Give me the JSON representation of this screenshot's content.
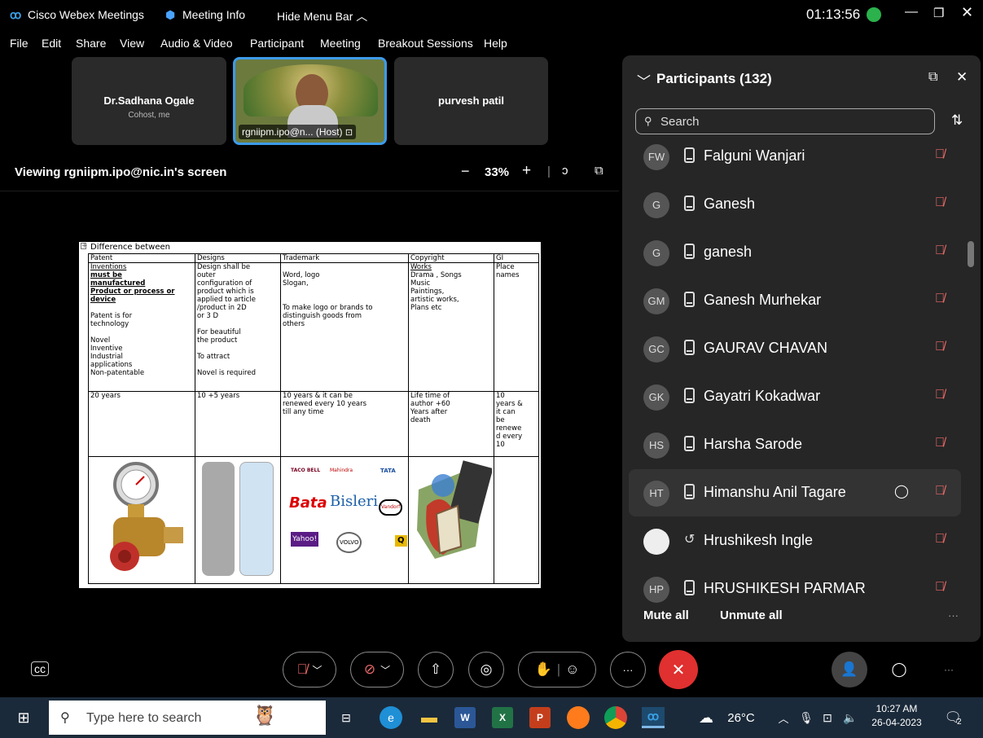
{
  "window": {
    "app_title": "Cisco Webex Meetings",
    "meeting_info": "Meeting Info",
    "hide_menu": "Hide Menu Bar",
    "timer": "01:13:56"
  },
  "menu": [
    "File",
    "Edit",
    "Share",
    "View",
    "Audio & Video",
    "Participant",
    "Meeting",
    "Breakout Sessions",
    "Help"
  ],
  "tiles": {
    "left": {
      "name": "Dr.Sadhana Ogale",
      "sub": "Cohost, me"
    },
    "center": {
      "label": "rgniipm.ipo@n... (Host)"
    },
    "right": {
      "name": "purvesh patil"
    }
  },
  "viewing": {
    "text": "Viewing rgniipm.ipo@nic.in's screen",
    "zoom": "33%",
    "minus": "−",
    "plus": "+"
  },
  "slide": {
    "title": "Difference between",
    "headers": [
      "Patent",
      "Designs",
      "Trademark",
      "Copyright",
      "GI"
    ],
    "row1": {
      "patent": [
        "Inventions",
        "must be",
        "manufactured",
        "Product  or process or",
        "device",
        "",
        "Patent is for",
        "technology",
        "",
        "Novel",
        "Inventive",
        "Industrial",
        "applications",
        "Non-patentable"
      ],
      "design": [
        "Design shall be",
        "outer",
        "configuration of",
        "product which is",
        "applied to article",
        "/product  in 2D",
        "or 3 D",
        "",
        "For beautiful",
        "the product",
        "",
        "To attract",
        "",
        "Novel is required"
      ],
      "trademark": [
        "",
        "Word, logo",
        "Slogan,",
        "",
        "",
        "To make logo or brands to",
        "distinguish  goods from",
        "others"
      ],
      "copyright": [
        "Works",
        "Drama , Songs",
        "Music",
        "Paintings,",
        "artistic works,",
        "Plans  etc"
      ],
      "gi": [
        "Place",
        "names"
      ]
    },
    "row2": {
      "patent": "20 years",
      "design": "10 +5 years",
      "trademark": [
        "10 years & it can be",
        "renewed  every  10 years",
        "till any time"
      ],
      "copyright": [
        "Life time of",
        "author +60",
        "Years after",
        "death"
      ],
      "gi": [
        "10",
        "years &",
        "it can",
        "be",
        "renewe",
        "d  every",
        "10"
      ]
    },
    "brands": [
      "TACO BELL",
      "Mahindra",
      "TATA",
      "Bata",
      "Bisleri",
      "Vandorf",
      "Yahoo!",
      "VOLVO",
      "Q"
    ]
  },
  "participants": {
    "header": "Participants (132)",
    "search_placeholder": "Search",
    "list": [
      {
        "initials": "FW",
        "name": "Falguni Wanjari"
      },
      {
        "initials": "G",
        "name": "Ganesh"
      },
      {
        "initials": "G",
        "name": "ganesh"
      },
      {
        "initials": "GM",
        "name": "Ganesh Murhekar"
      },
      {
        "initials": "GC",
        "name": "GAURAV CHAVAN"
      },
      {
        "initials": "GK",
        "name": "Gayatri Kokadwar"
      },
      {
        "initials": "HS",
        "name": "Harsha Sarode"
      },
      {
        "initials": "HT",
        "name": "Himanshu Anil Tagare"
      },
      {
        "initials": "",
        "name": "Hrushikesh Ingle"
      },
      {
        "initials": "HP",
        "name": "HRUSHIKESH PARMAR"
      }
    ],
    "mute_all": "Mute all",
    "unmute_all": "Unmute all",
    "more": "···"
  },
  "taskbar": {
    "search_placeholder": "Type here to search",
    "weather": "26°C",
    "time": "10:27 AM",
    "date": "26-04-2023",
    "notif_count": "2"
  },
  "colors": {
    "accent_red": "#e0302f",
    "muted_icon": "#ef6a6a",
    "host_border": "#3d9be9",
    "taskbar": "#1b2a3a"
  }
}
